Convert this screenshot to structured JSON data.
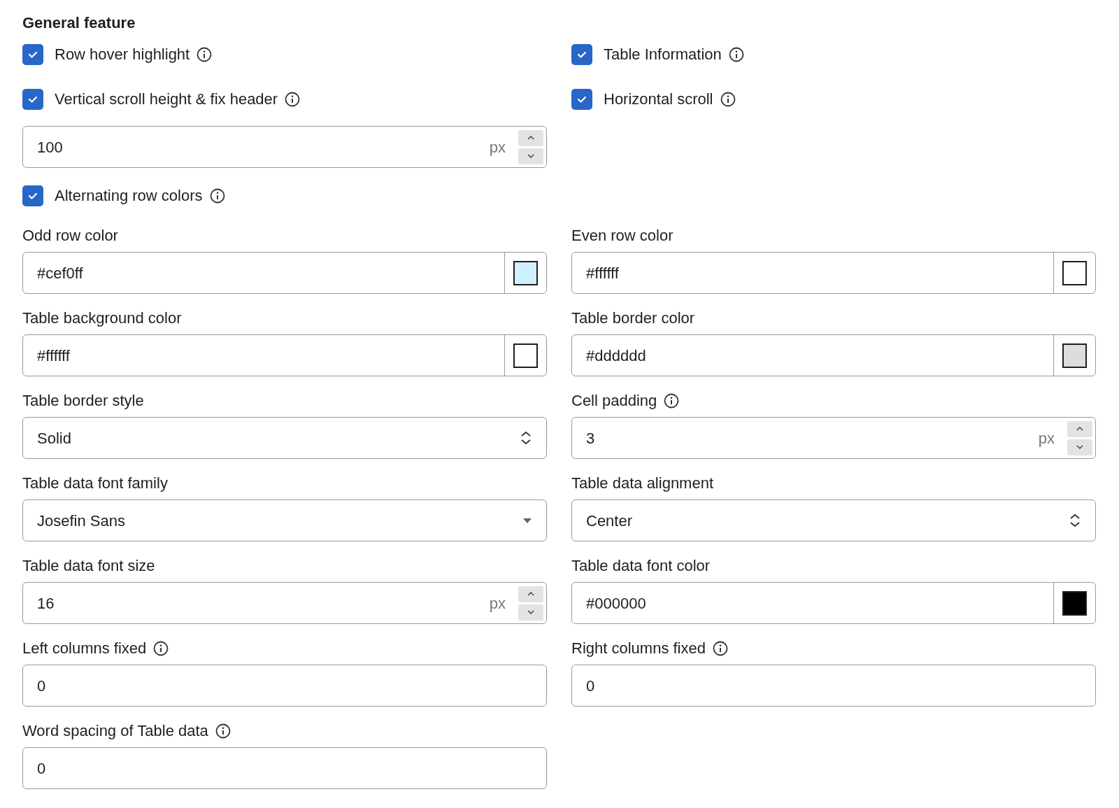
{
  "title": "General feature",
  "rows": [
    [
      {
        "kind": "checkbox",
        "label": "Row hover highlight",
        "checked": true,
        "info": true
      },
      {
        "kind": "checkbox",
        "label": "Table Information",
        "checked": true,
        "info": true
      }
    ],
    [
      {
        "kind": "checkbox",
        "label": "Vertical scroll height & fix header",
        "checked": true,
        "info": true
      },
      {
        "kind": "checkbox",
        "label": "Horizontal scroll",
        "checked": true,
        "info": true
      }
    ],
    [
      {
        "kind": "number",
        "value": "100",
        "unit": "px"
      }
    ],
    [
      {
        "kind": "checkbox",
        "label": "Alternating row colors",
        "checked": true,
        "info": true
      }
    ],
    [
      {
        "kind": "color",
        "label": "Odd row color",
        "value": "#cef0ff",
        "color": "#cef0ff"
      },
      {
        "kind": "color",
        "label": "Even row color",
        "value": "#ffffff",
        "color": "#ffffff"
      }
    ],
    [
      {
        "kind": "color",
        "label": "Table background color",
        "value": "#ffffff",
        "color": "#ffffff"
      },
      {
        "kind": "color",
        "label": "Table border color",
        "value": "#dddddd",
        "color": "#dddddd"
      }
    ],
    [
      {
        "kind": "select",
        "label": "Table border style",
        "value": "Solid"
      },
      {
        "kind": "number",
        "label": "Cell padding",
        "info": true,
        "value": "3",
        "unit": "px"
      }
    ],
    [
      {
        "kind": "dropdown",
        "label": "Table data font family",
        "value": "Josefin Sans"
      },
      {
        "kind": "select",
        "label": "Table data alignment",
        "value": "Center"
      }
    ],
    [
      {
        "kind": "number",
        "label": "Table data font size",
        "value": "16",
        "unit": "px"
      },
      {
        "kind": "color",
        "label": "Table data font color",
        "value": "#000000",
        "color": "#000000"
      }
    ],
    [
      {
        "kind": "text",
        "label": "Left columns fixed",
        "info": true,
        "value": "0"
      },
      {
        "kind": "text",
        "label": "Right columns fixed",
        "info": true,
        "value": "0"
      }
    ],
    [
      {
        "kind": "text",
        "label": "Word spacing of Table data",
        "info": true,
        "value": "0"
      }
    ]
  ]
}
